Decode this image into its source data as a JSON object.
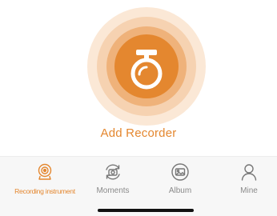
{
  "accent_color": "#e4872f",
  "main": {
    "add_label": "Add Recorder",
    "add_icon": "dashcam-icon"
  },
  "tab_bar": {
    "tabs": [
      {
        "label": "Recording instrument",
        "icon": "dashcam-icon",
        "active": true
      },
      {
        "label": "Moments",
        "icon": "moments-icon",
        "active": false
      },
      {
        "label": "Album",
        "icon": "album-icon",
        "active": false
      },
      {
        "label": "Mine",
        "icon": "person-icon",
        "active": false
      }
    ]
  }
}
